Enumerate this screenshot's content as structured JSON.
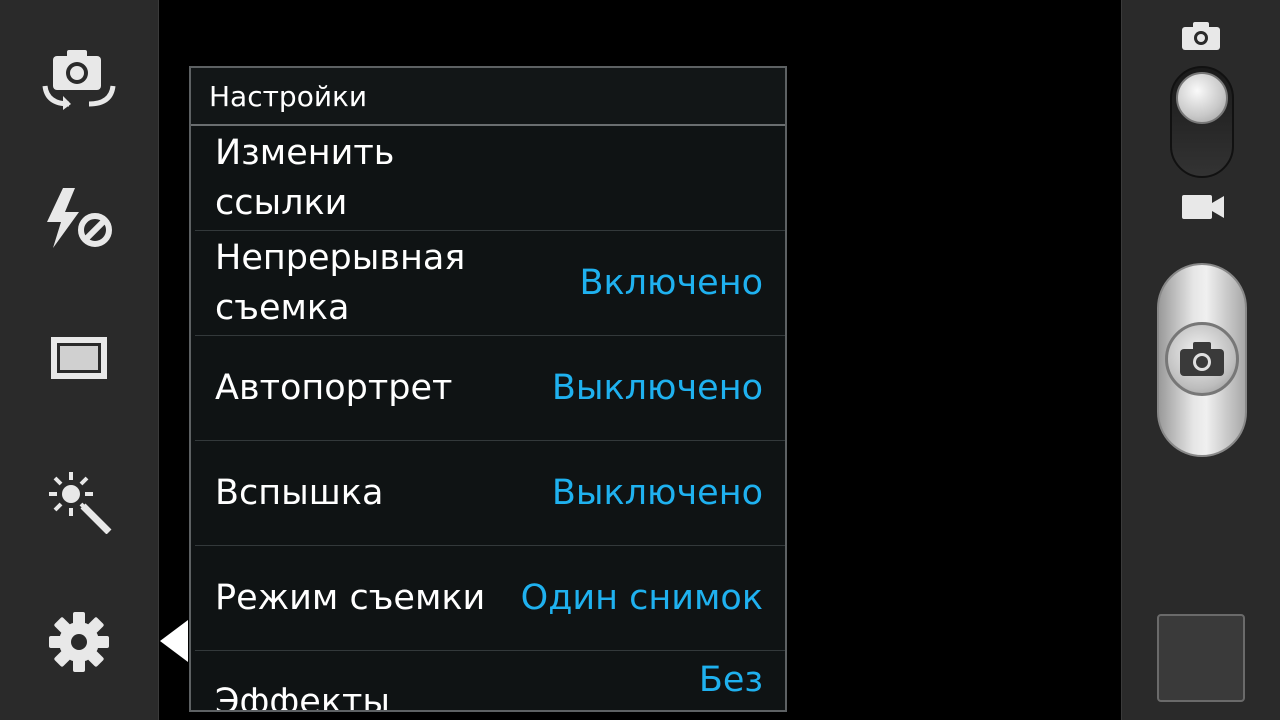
{
  "toolbar_left": {
    "items": [
      {
        "icon": "switch-camera-icon"
      },
      {
        "icon": "flash-off-icon"
      },
      {
        "icon": "aspect-ratio-icon"
      },
      {
        "icon": "effects-wand-icon"
      },
      {
        "icon": "gear-icon"
      }
    ]
  },
  "settings": {
    "title": "Настройки",
    "rows": [
      {
        "label": "Изменить ссылки",
        "value": ""
      },
      {
        "label": "Непрерывная съемка",
        "value": "Включено"
      },
      {
        "label": "Автопортрет",
        "value": "Выключено"
      },
      {
        "label": "Вспышка",
        "value": "Выключено"
      },
      {
        "label": "Режим съемки",
        "value": "Один снимок"
      },
      {
        "label": "Эффекты",
        "value": "Без"
      }
    ]
  },
  "toolbar_right": {
    "mode_selected": "camera",
    "icons": [
      "camera-mode-icon",
      "video-mode-icon",
      "shutter-camera-icon"
    ]
  },
  "colors": {
    "accent": "#1fb1ef",
    "panel_bg": "#0f1314",
    "bar_bg": "#2a2a2a"
  }
}
